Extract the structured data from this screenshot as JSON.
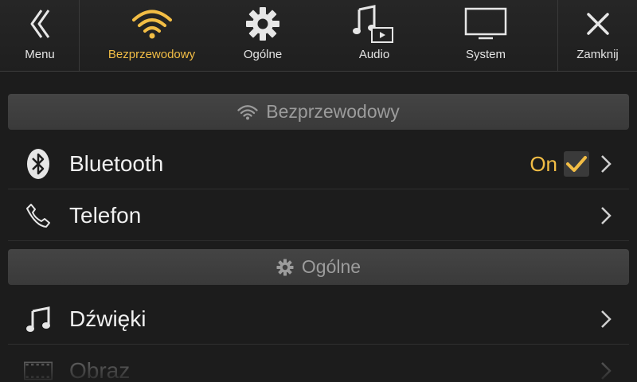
{
  "topbar": {
    "menu_label": "Menu",
    "tabs": [
      {
        "label": "Bezprzewodowy",
        "icon": "wifi-icon",
        "active": true
      },
      {
        "label": "Ogólne",
        "icon": "gear-icon",
        "active": false
      },
      {
        "label": "Audio",
        "icon": "music-video-icon",
        "active": false
      },
      {
        "label": "System",
        "icon": "monitor-icon",
        "active": false
      }
    ],
    "close_label": "Zamknij"
  },
  "sections": [
    {
      "title": "Bezprzewodowy",
      "icon": "wifi-icon",
      "items": [
        {
          "label": "Bluetooth",
          "icon": "bluetooth-icon",
          "state": "On",
          "checked": true
        },
        {
          "label": "Telefon",
          "icon": "phone-icon"
        }
      ]
    },
    {
      "title": "Ogólne",
      "icon": "gear-icon",
      "items": [
        {
          "label": "Dźwięki",
          "icon": "music-note-icon"
        },
        {
          "label": "Obraz",
          "icon": "film-icon"
        }
      ]
    }
  ],
  "colors": {
    "accent": "#f2bd45",
    "background": "#1c1c1c",
    "section_bar": "#404040"
  }
}
